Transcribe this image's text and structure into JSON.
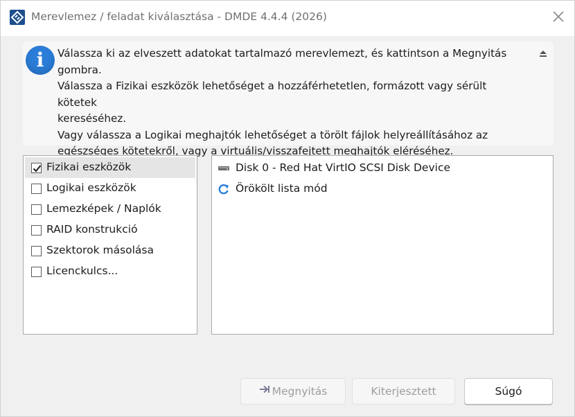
{
  "window": {
    "title": "Merevlemez / feladat kiválasztása - DMDE 4.4.4 (2026)",
    "app_icon": "dmde-logo-icon",
    "close_icon": "close-icon"
  },
  "info": {
    "icon": "info-icon",
    "icon_glyph": "i",
    "lines": [
      "Válassza ki az elveszett adatokat tartalmazó merevlemezt, és kattintson a Megnyitás",
      "gombra.",
      "Válassza a Fizikai eszközök lehetőséget a hozzáférhetetlen, formázott vagy sérült kötetek",
      "kereséséhez.",
      "Vagy válassza a Logikai meghajtók lehetőséget a törölt fájlok helyreállításához az",
      "egészséges kötetekről, vagy a virtuális/visszafejtett meghajtók eléréséhez."
    ],
    "collapse_icon": "collapse-up-icon"
  },
  "options": [
    {
      "label": "Fizikai eszközök",
      "checked": true,
      "selected": true
    },
    {
      "label": "Logikai eszközök",
      "checked": false,
      "selected": false
    },
    {
      "label": "Lemezképek / Naplók",
      "checked": false,
      "selected": false
    },
    {
      "label": "RAID konstrukció",
      "checked": false,
      "selected": false
    },
    {
      "label": "Szektorok másolása",
      "checked": false,
      "selected": false
    },
    {
      "label": "Licenckulcs...",
      "checked": false,
      "selected": false
    }
  ],
  "devices": [
    {
      "label": "Disk 0 - Red Hat VirtIO SCSI Disk Device",
      "icon": "disk-drive-icon"
    },
    {
      "label": "Örökölt lista mód",
      "icon": "refresh-icon"
    }
  ],
  "buttons": {
    "open": {
      "label": "Megnyitás",
      "enabled": false,
      "icon": "arrow-right-icon"
    },
    "extended": {
      "label": "Kiterjesztett",
      "enabled": false
    },
    "help": {
      "label": "Súgó",
      "enabled": true
    }
  },
  "colors": {
    "accent": "#2a7dd8",
    "app_icon_bg": "#1d4f8c",
    "disabled_text": "#9d9d9d",
    "selection_bg": "#e5e5e5"
  }
}
